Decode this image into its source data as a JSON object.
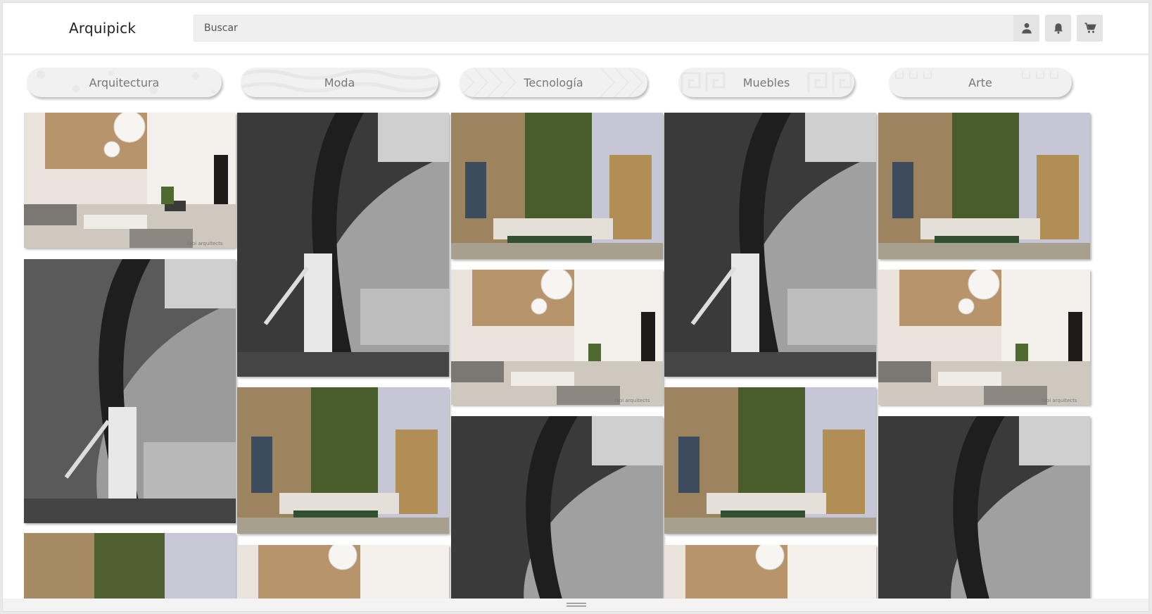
{
  "app": {
    "brand": "Arquipick"
  },
  "search": {
    "placeholder": "Buscar"
  },
  "header_icons": [
    "user-icon",
    "bell-icon",
    "cart-icon"
  ],
  "categories": [
    "Arquitectura",
    "Moda",
    "Tecnología",
    "Muebles",
    "Arte"
  ],
  "images": {
    "kinds": [
      "living-room-render",
      "staircase-bw-render",
      "green-wall-render"
    ],
    "watermark": "fabi arquitects"
  },
  "colors": {
    "accent": "#efefef",
    "text": "#222222"
  }
}
